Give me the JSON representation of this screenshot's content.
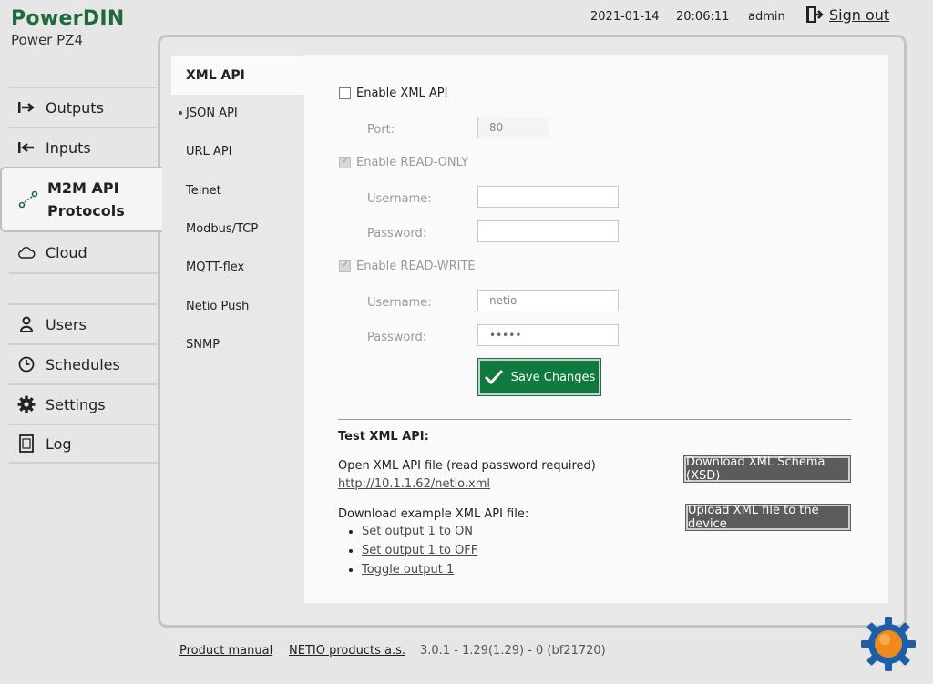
{
  "brand": {
    "title": "PowerDIN",
    "subtitle": "Power PZ4"
  },
  "topbar": {
    "date": "2021-01-14",
    "time": "20:06:11",
    "user": "admin",
    "signout": "Sign out"
  },
  "nav": {
    "outputs": "Outputs",
    "inputs": "Inputs",
    "m2m_line1": "M2M API",
    "m2m_line2": "Protocols",
    "cloud": "Cloud",
    "users": "Users",
    "schedules": "Schedules",
    "settings": "Settings",
    "log": "Log"
  },
  "subnav": {
    "xml": "XML API",
    "json": "JSON API",
    "url": "URL API",
    "telnet": "Telnet",
    "modbus": "Modbus/TCP",
    "mqtt": "MQTT-flex",
    "push": "Netio Push",
    "snmp": "SNMP"
  },
  "form": {
    "enable_xml": "Enable XML API",
    "port_label": "Port:",
    "port_value": "80",
    "enable_ro": "Enable READ-ONLY",
    "ro_user_label": "Username:",
    "ro_user_value": "",
    "ro_pass_label": "Password:",
    "ro_pass_value": "",
    "enable_rw": "Enable READ-WRITE",
    "rw_user_label": "Username:",
    "rw_user_value": "netio",
    "rw_pass_label": "Password:",
    "rw_pass_value": "•••••",
    "save": "Save Changes"
  },
  "test": {
    "title": "Test XML API:",
    "open_text": "Open XML API file (read password required)",
    "open_link": "http://10.1.1.62/netio.xml",
    "download_schema": "Download XML Schema (XSD)",
    "download_example": "Download example XML API file:",
    "upload": "Upload XML file to the device",
    "example_1": "Set output 1 to ON",
    "example_2": "Set output 1 to OFF",
    "example_3": "Toggle output 1"
  },
  "footer": {
    "manual": "Product manual",
    "company": "NETIO products a.s.",
    "version": "3.0.1 - 1.29(1.29) - 0 (bf21720)"
  }
}
